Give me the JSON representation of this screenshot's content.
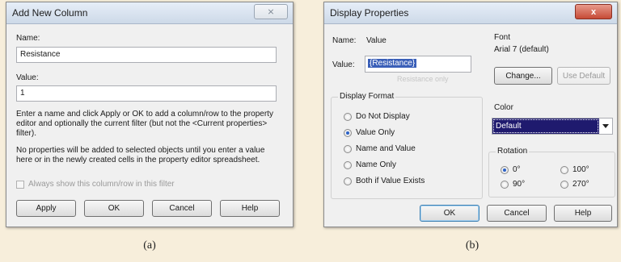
{
  "add_column": {
    "title": "Add New Column",
    "close_glyph": "⨯",
    "name_label": "Name:",
    "name_value": "Resistance",
    "value_label": "Value:",
    "value_value": "1",
    "help_text_1": "Enter a name and click Apply or OK to add a column/row to the property editor and optionally the current filter (but not the <Current properties> filter).",
    "help_text_2": "No properties will be added to selected objects until you enter a value here or in the newly created cells in the property editor spreadsheet.",
    "checkbox_label": "Always show this column/row in this filter",
    "buttons": {
      "apply": "Apply",
      "ok": "OK",
      "cancel": "Cancel",
      "help": "Help"
    },
    "caption": "(a)"
  },
  "display_props": {
    "title": "Display Properties",
    "close_glyph": "x",
    "name_label": "Name:",
    "name_value": "Value",
    "value_label": "Value:",
    "value_value": "{Resistance}",
    "value_ghost": "Resistance only",
    "font_label": "Font",
    "font_value": "Arial 7 (default)",
    "change_button": "Change...",
    "use_default_button": "Use Default",
    "display_format_label": "Display Format",
    "display_format_options": [
      "Do Not Display",
      "Value Only",
      "Name and Value",
      "Name Only",
      "Both if Value Exists"
    ],
    "display_format_selected": "Value Only",
    "color_label": "Color",
    "color_value": "Default",
    "rotation_label": "Rotation",
    "rotation_options": [
      "0°",
      "100°",
      "90°",
      "270°"
    ],
    "rotation_selected": "0°",
    "buttons": {
      "ok": "OK",
      "cancel": "Cancel",
      "help": "Help"
    },
    "caption": "(b)"
  },
  "colors": {
    "background": "#f7eedb",
    "dialog": "#f0f0f0",
    "selection": "#1f1a6e",
    "accent": "#2c62c7"
  }
}
